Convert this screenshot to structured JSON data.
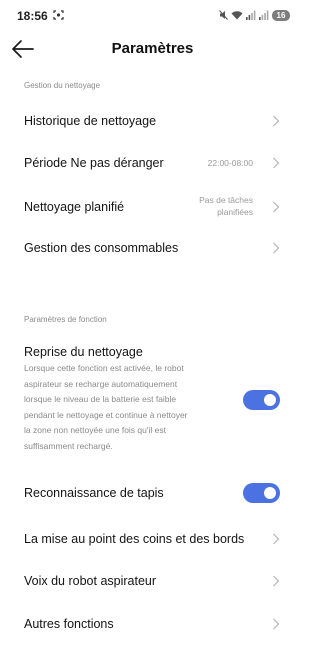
{
  "status_bar": {
    "time": "18:56",
    "battery": "16"
  },
  "header": {
    "title": "Paramètres",
    "back_icon": "arrow-left-icon"
  },
  "sections": {
    "cleaning": {
      "title": "Gestion du nettoyage",
      "items": [
        {
          "label": "Historique de nettoyage"
        },
        {
          "label": "Période Ne pas déranger",
          "value": "22:00-08:00"
        },
        {
          "label": "Nettoyage planifié",
          "value_line1": "Pas de tâches",
          "value_line2": "planifiées"
        },
        {
          "label": "Gestion des consommables"
        }
      ]
    },
    "functions": {
      "title": "Paramètres de fonction",
      "resume": {
        "label": "Reprise du nettoyage",
        "description": [
          "Lorsque cette fonction est activée, le robot",
          "aspirateur se recharge automatiquement",
          "lorsque le niveau de la batterie est faible",
          "pendant le nettoyage et continue à nettoyer",
          "la zone non nettoyée une fois qu'il est",
          "suffisamment rechargé."
        ],
        "enabled": true
      },
      "carpet": {
        "label": "Reconnaissance de tapis",
        "enabled": true
      },
      "items": [
        {
          "label": "La mise au point des coins et des bords"
        },
        {
          "label": "Voix du robot aspirateur"
        },
        {
          "label": "Autres fonctions"
        }
      ]
    }
  },
  "colors": {
    "accent": "#4b72e0",
    "section_title": "#8b8b8b",
    "secondary_text": "#9a9a9a"
  }
}
